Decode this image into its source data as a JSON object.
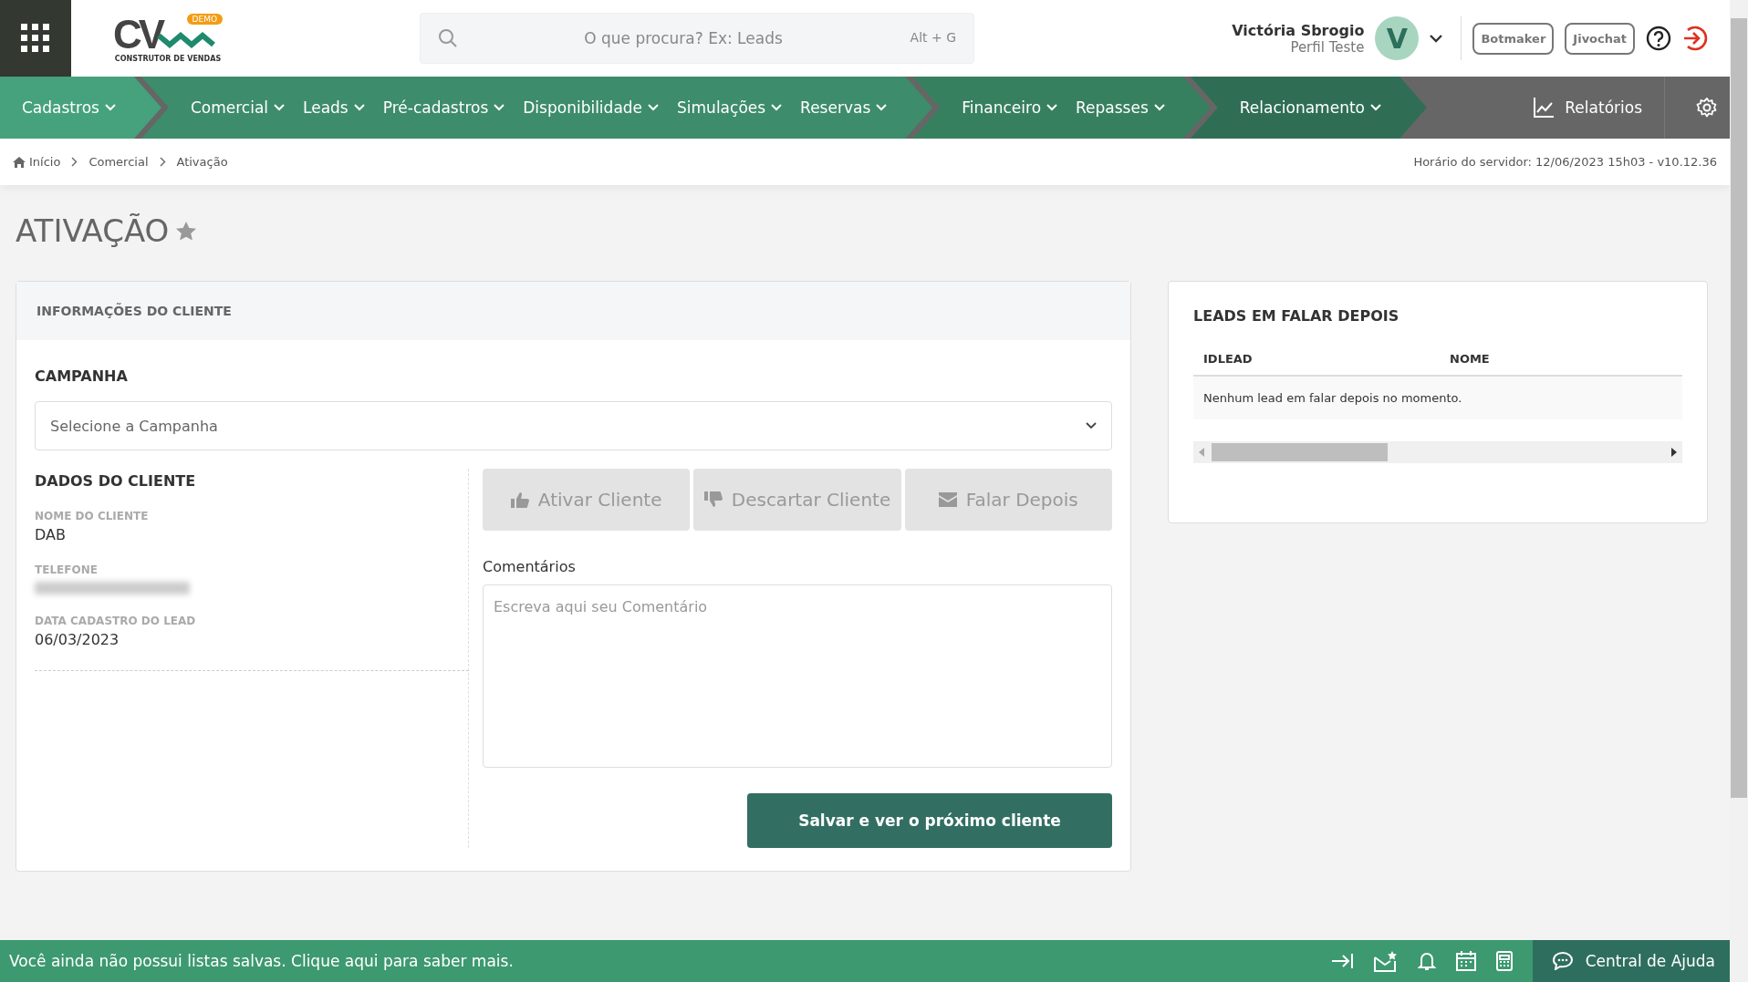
{
  "header": {
    "logo_text": "CV",
    "logo_badge": "DEMO",
    "logo_tagline": "CONSTRUTOR DE VENDAS",
    "search": {
      "placeholder": "O que procura? Ex: Leads",
      "shortcut": "Alt + G"
    },
    "user": {
      "name": "Victória Sbrogio",
      "profile": "Perfil Teste",
      "initial": "V"
    },
    "buttons": [
      "Botmaker",
      "Jivochat"
    ]
  },
  "nav": {
    "groups": [
      {
        "items": [
          "Cadastros"
        ]
      },
      {
        "items": [
          "Comercial",
          "Leads",
          "Pré-cadastros",
          "Disponibilidade",
          "Simulações",
          "Reservas"
        ]
      },
      {
        "items": [
          "Financeiro",
          "Repasses"
        ]
      },
      {
        "items": [
          "Relacionamento"
        ]
      }
    ],
    "reports": "Relatórios"
  },
  "breadcrumb": {
    "items": [
      "Início",
      "Comercial",
      "Ativação"
    ],
    "server_time": "Horário do servidor: 12/06/2023 15h03 - v10.12.36"
  },
  "page_title": "ATIVAÇÃO",
  "client_card": {
    "title": "INFORMAÇÕES DO CLIENTE",
    "campaign_label": "CAMPANHA",
    "campaign_select": {
      "placeholder": "Selecione a Campanha"
    },
    "section_title": "DADOS DO CLIENTE",
    "fields": [
      {
        "label": "NOME DO CLIENTE",
        "kind": "text",
        "value": "DAB"
      },
      {
        "label": "TELEFONE",
        "kind": "blurred"
      },
      {
        "label": "DATA CADASTRO DO LEAD",
        "kind": "text",
        "value": "06/03/2023"
      }
    ],
    "actions": [
      {
        "label": "Ativar Cliente",
        "disabled": true
      },
      {
        "label": "Descartar Cliente",
        "disabled": true
      },
      {
        "label": "Falar Depois",
        "disabled": true
      }
    ],
    "comments_label": "Comentários",
    "comments": {
      "placeholder": "Escreva aqui seu Comentário"
    },
    "save_button": "Salvar e ver o próximo cliente"
  },
  "leads_card": {
    "title": "LEADS EM FALAR DEPOIS",
    "columns": [
      "IDLEAD",
      "NOME"
    ],
    "empty_message": "Nenhum lead em falar depois no momento."
  },
  "bottom_bar": {
    "message": "Você ainda não possui listas salvas. Clique aqui para saber mais.",
    "help": "Central de Ajuda"
  }
}
